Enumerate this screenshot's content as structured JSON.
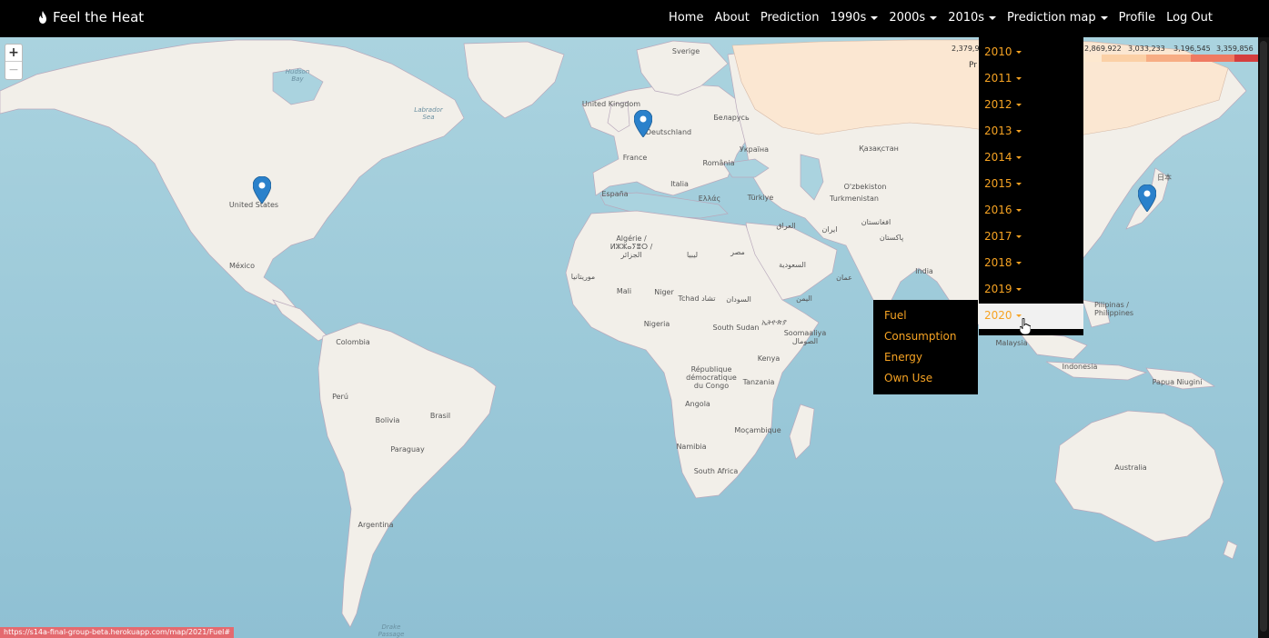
{
  "navbar": {
    "brand": "Feel the Heat",
    "items": [
      {
        "label": "Home",
        "caret": false
      },
      {
        "label": "About",
        "caret": false
      },
      {
        "label": "Prediction",
        "caret": false
      },
      {
        "label": "1990s",
        "caret": true
      },
      {
        "label": "2000s",
        "caret": true
      },
      {
        "label": "2010s",
        "caret": true
      },
      {
        "label": "Prediction map",
        "caret": true
      },
      {
        "label": "Profile",
        "caret": false
      },
      {
        "label": "Log Out",
        "caret": false
      }
    ]
  },
  "map": {
    "zoom_in": "+",
    "zoom_out": "−",
    "labels": {
      "sverige": "Sverige",
      "hudson_bay": "Hudson\nBay",
      "labrador_sea": "Labrador\nSea",
      "united_kingdom": "United Kingdom",
      "deutschland": "Deutschland",
      "belarus": "Беларусь",
      "ukraina": "Україна",
      "kazakhstan": "Қазақстан",
      "france": "France",
      "romania": "România",
      "espana": "España",
      "italia": "Italia",
      "ellas": "Ελλάς",
      "turkiye": "Türkiye",
      "ozbekiston": "O'zbekiston",
      "turkmenistan": "Turkmenistan",
      "iraq": "العراق",
      "afghanistan": "افغانستان",
      "iran": "ایران",
      "pakistan": "پاکستان",
      "united_states": "United States",
      "mexico": "México",
      "algerie": "Algérie /\nⵍⵣⵣⴰⵢⴻⵔ /\nالجزائر",
      "libya": "ليبيا",
      "misr": "مصر",
      "saudi": "السعودية",
      "mauritanie": "موريتانيا",
      "mali": "Mali",
      "niger": "Niger",
      "tchad": "Tchad تشاد",
      "sudan": "السودان",
      "yemen": "اليمن",
      "oman": "عمان",
      "india": "India",
      "nigeria": "Nigeria",
      "south_sudan": "South Sudan",
      "ethiopia": "ኢትዮጵያ",
      "somalia": "Soomaaliya\nالصومال",
      "kenya": "Kenya",
      "rdc": "République\ndémocratique\ndu Congo",
      "tanzania": "Tanzania",
      "colombia": "Colombia",
      "peru": "Perú",
      "brasil": "Brasil",
      "bolivia": "Bolivia",
      "paraguay": "Paraguay",
      "argentina": "Argentina",
      "angola": "Angola",
      "mocambique": "Moçambique",
      "namibia": "Namibia",
      "south_africa": "South Africa",
      "malaysia": "Malaysia",
      "indonesia": "Indonesia",
      "papua": "Papua Niugini",
      "australia": "Australia",
      "nihon": "日本",
      "philippines": "Pilipinas /\nPhilippines",
      "drake": "Drake\nPassage"
    }
  },
  "legend": {
    "values": [
      "2,379,9",
      "2,869,922",
      "3,033,233",
      "3,196,545",
      "3,359,856"
    ],
    "label": "Pr",
    "colors": [
      "#fde8cf",
      "#fbd0a6",
      "#f7ad84",
      "#ef7a62",
      "#d43e3e"
    ]
  },
  "dropdown": {
    "years": [
      "2010",
      "2011",
      "2012",
      "2013",
      "2014",
      "2015",
      "2016",
      "2017",
      "2018",
      "2019",
      "2020"
    ],
    "active": "2020"
  },
  "submenu": {
    "items": [
      "Fuel",
      "Consumption",
      "Energy",
      "Own Use"
    ]
  },
  "status_url": "https://s14a-final-group-beta.herokuapp.com/map/2021/Fuel#",
  "colors": {
    "accent": "#f6a323",
    "navbar": "#000000",
    "ocean": "#aad3df",
    "land": "#f2efe9",
    "marker": "#2a81cb"
  }
}
